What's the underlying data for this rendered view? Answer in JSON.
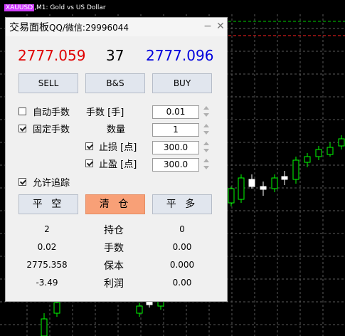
{
  "chart": {
    "symbol_tag": "XAUUSD",
    "title_rest": ",M1: Gold vs US Dollar",
    "colors": {
      "bull": "#00ff00",
      "bear": "#ffffff",
      "grid": "#5a5a5a",
      "level_green": "#00cc00",
      "level_red": "#ff2020"
    }
  },
  "panel": {
    "title": "交易面板",
    "contact": "QQ/微信:29996044",
    "bid": "2777.059",
    "spread": "37",
    "ask": "2777.096",
    "buttons": {
      "sell": "SELL",
      "bs": "B&S",
      "buy": "BUY",
      "close_short": "平 空",
      "clear": "清 仓",
      "close_long": "平 多"
    },
    "auto_lot": {
      "label": "自动手数",
      "checked": false
    },
    "fixed_lot": {
      "label": "固定手数",
      "checked": true
    },
    "lots_label": "手数 [手]",
    "lots_value": "0.01",
    "qty_label": "数量",
    "qty_value": "1",
    "stop_loss": {
      "label": "止损 [点]",
      "checked": true,
      "value": "300.0"
    },
    "take_profit": {
      "label": "止盈 [点]",
      "checked": true,
      "value": "300.0"
    },
    "trailing": {
      "label": "允许追踪",
      "checked": true
    },
    "stats": [
      {
        "left": "2",
        "label": "持仓",
        "right": "0"
      },
      {
        "left": "0.02",
        "label": "手数",
        "right": "0.00"
      },
      {
        "left": "2775.358",
        "label": "保本",
        "right": "0.000"
      },
      {
        "left": "-3.49",
        "label": "利润",
        "right": "0.00"
      }
    ]
  }
}
